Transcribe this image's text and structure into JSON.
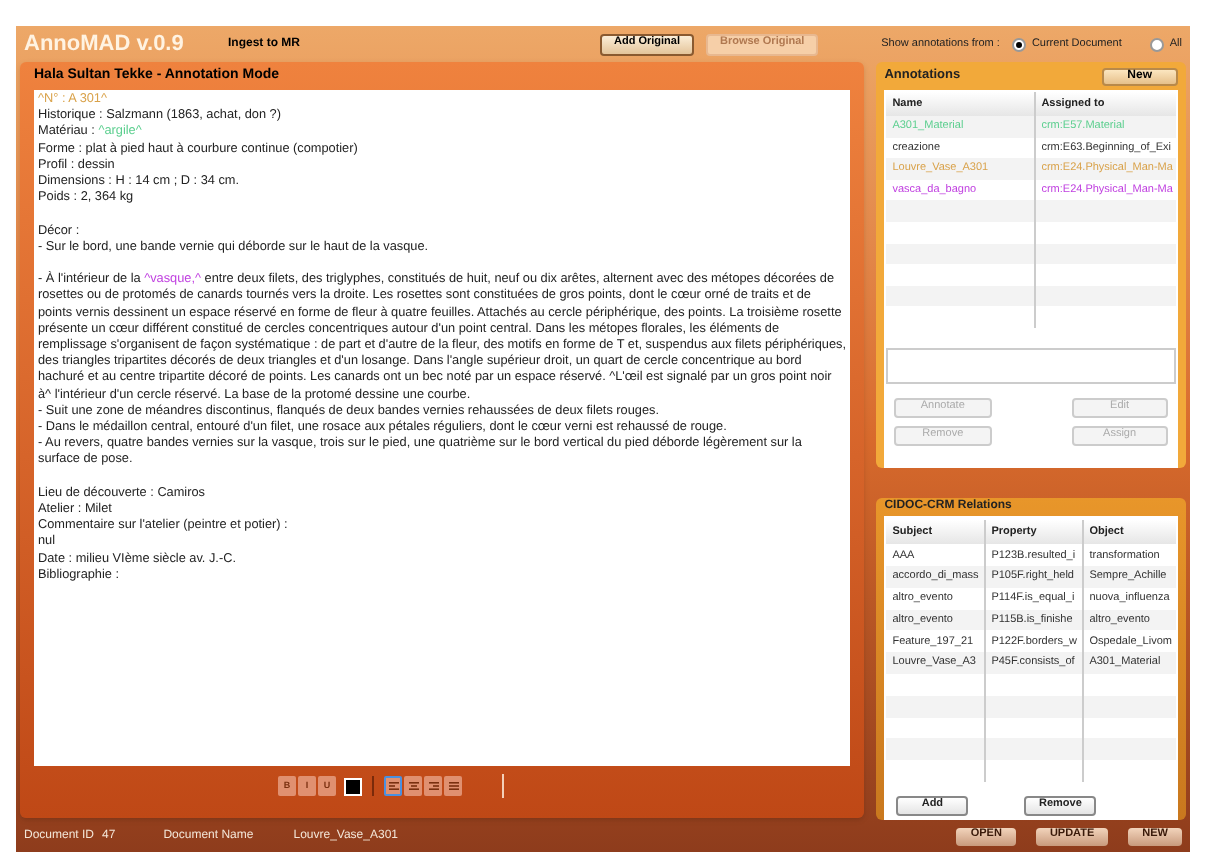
{
  "app": {
    "title": "AnnoMAD v.0.9",
    "ingest_link": "Ingest to MR"
  },
  "toolbar": {
    "buttons": [
      {
        "label": "Add Original",
        "disabled": false
      },
      {
        "label": "Browse Original",
        "disabled": true
      }
    ],
    "show_from_label": "Show annotations from :",
    "radios": [
      {
        "label": "Current Document",
        "selected": true
      },
      {
        "label": "All",
        "selected": false
      }
    ]
  },
  "editor": {
    "title": "Hala Sultan Tekke - Annotation Mode",
    "paragraphs": [
      {
        "gap_before": false,
        "segments": [
          {
            "text": "^N° : A 301^",
            "color": "#d9a24a"
          }
        ]
      },
      {
        "gap_before": false,
        "segments": [
          {
            "text": "Historique : Salzmann (1863, achat, don ?)"
          }
        ]
      },
      {
        "gap_before": false,
        "segments": [
          {
            "text": "Matériau : "
          },
          {
            "text": "^argile^",
            "color": "#5ccf8f"
          }
        ]
      },
      {
        "gap_before": false,
        "segments": [
          {
            "text": "Forme : plat à pied haut à courbure continue (compotier)"
          }
        ]
      },
      {
        "gap_before": false,
        "segments": [
          {
            "text": "Profil : dessin"
          }
        ]
      },
      {
        "gap_before": false,
        "segments": [
          {
            "text": "Dimensions : H : 14 cm ; D : 34 cm."
          }
        ]
      },
      {
        "gap_before": false,
        "segments": [
          {
            "text": "Poids : 2, 364 kg"
          }
        ]
      },
      {
        "gap_before": true,
        "segments": [
          {
            "text": "Décor :"
          }
        ]
      },
      {
        "gap_before": false,
        "segments": [
          {
            "text": "- Sur le bord, une bande vernie qui déborde sur le haut de la vasque."
          }
        ]
      },
      {
        "gap_before": true,
        "segments": [
          {
            "text": "- À l'intérieur de la "
          },
          {
            "text": "^vasque,^",
            "color": "#c040e0"
          },
          {
            "text": " entre deux filets, des triglyphes, constitués de huit, neuf ou dix arêtes, alternent avec des métopes décorées de rosettes ou de protomés de canards tournés vers la droite. Les rosettes sont constituées de gros points, dont le cœur orné de traits et de points vernis dessinent un espace réservé en forme de fleur à quatre feuilles. Attachés au cercle périphérique, des points. La troisième rosette présente un cœur différent constitué de cercles concentriques autour d'un point central. Dans les métopes florales, les éléments de remplissage s'organisent de façon systématique : de part et d'autre de la fleur, des motifs en forme de T et, suspendus aux filets périphériques, des triangles tripartites décorés de deux triangles et d'un losange. Dans l'angle supérieur droit, un quart de cercle concentrique au bord hachuré et au centre tripartite décoré de points. Les canards ont un bec noté par un espace réservé. ^L'œil est signalé par un gros point noir à^ l'intérieur d'un cercle réservé. La base de la protomé dessine une courbe."
          }
        ]
      },
      {
        "gap_before": false,
        "segments": [
          {
            "text": "- Suit une zone de méandres discontinus, flanqués de deux bandes vernies rehaussées de deux filets rouges."
          }
        ]
      },
      {
        "gap_before": false,
        "segments": [
          {
            "text": "- Dans le médaillon central, entouré d'un filet, une rosace aux pétales réguliers, dont le cœur verni est rehaussé de rouge."
          }
        ]
      },
      {
        "gap_before": false,
        "segments": [
          {
            "text": "- Au revers, quatre bandes vernies sur la vasque, trois sur le pied, une quatrième sur le bord vertical du pied déborde légèrement sur la surface de pose."
          }
        ]
      },
      {
        "gap_before": true,
        "segments": [
          {
            "text": "Lieu de découverte : Camiros"
          }
        ]
      },
      {
        "gap_before": false,
        "segments": [
          {
            "text": "Atelier : Milet"
          }
        ]
      },
      {
        "gap_before": false,
        "segments": [
          {
            "text": "Commentaire sur  l'atelier (peintre et potier) :"
          }
        ]
      },
      {
        "gap_before": false,
        "segments": [
          {
            "text": "nul"
          }
        ]
      },
      {
        "gap_before": false,
        "segments": [
          {
            "text": "Date : milieu VIème siècle av. J.-C."
          }
        ]
      },
      {
        "gap_before": false,
        "segments": [
          {
            "text": "Bibliographie :"
          }
        ]
      }
    ],
    "format_buttons": [
      {
        "label": "B"
      },
      {
        "label": "I"
      },
      {
        "label": "U"
      }
    ],
    "align_buttons": [
      {
        "kind": "left",
        "selected": true
      },
      {
        "kind": "center",
        "selected": false
      },
      {
        "kind": "right",
        "selected": false
      },
      {
        "kind": "justify",
        "selected": false
      }
    ]
  },
  "annotations": {
    "title": "Annotations",
    "new_button": "New",
    "columns": [
      "Name",
      "Assigned to"
    ],
    "rows": [
      {
        "name": "A301_Material",
        "assigned_to": "crm:E57.Material",
        "color": "#5ccf8f"
      },
      {
        "name": "creazione",
        "assigned_to": "crm:E63.Beginning_of_Exi",
        "color": "#333333"
      },
      {
        "name": "Louvre_Vase_A301",
        "assigned_to": "crm:E24.Physical_Man-Ma",
        "color": "#d9a24a"
      },
      {
        "name": "vasca_da_bagno",
        "assigned_to": "crm:E24.Physical_Man-Ma",
        "color": "#c040e0"
      }
    ],
    "buttons": [
      {
        "label": "Annotate",
        "disabled": true
      },
      {
        "label": "Edit",
        "disabled": true
      },
      {
        "label": "Remove",
        "disabled": true
      },
      {
        "label": "Assign",
        "disabled": true
      }
    ]
  },
  "relations": {
    "title": "CIDOC-CRM Relations",
    "columns": [
      "Subject",
      "Property",
      "Object"
    ],
    "rows": [
      [
        "AAA",
        "P123B.resulted_i",
        "transformation"
      ],
      [
        "accordo_di_mass",
        "P105F.right_held",
        "Sempre_Achille"
      ],
      [
        "altro_evento",
        "P114F.is_equal_i",
        "nuova_influenza"
      ],
      [
        "altro_evento",
        "P115B.is_finishe",
        "altro_evento"
      ],
      [
        "Feature_197_21",
        "P122F.borders_w",
        "Ospedale_Livom"
      ],
      [
        "Louvre_Vase_A3",
        "P45F.consists_of",
        "A301_Material"
      ]
    ],
    "buttons": [
      "Add",
      "Remove"
    ]
  },
  "footer": {
    "document_id_label": "Document ID",
    "document_id": "47",
    "document_name_label": "Document Name",
    "document_name": "Louvre_Vase_A301",
    "buttons": [
      "OPEN",
      "UPDATE",
      "NEW"
    ]
  }
}
